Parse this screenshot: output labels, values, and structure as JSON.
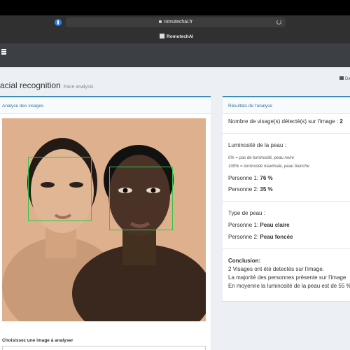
{
  "browser": {
    "url": "romutechai.fr",
    "tab_title": "RomutechAI"
  },
  "page": {
    "title": "acial recognition",
    "subtitle": "Face analysis",
    "breadcrumb": "Da"
  },
  "left_panel": {
    "header": "Analyse des visages",
    "choose_label": "Choisissez une image à analyser"
  },
  "right_panel": {
    "header": "Résultats de l'analyse",
    "faces_count_label": "Nombre de visage(s) détecté(s) sur l'image : ",
    "faces_count_value": "2",
    "luminosity_title": "Luminosité de la peau :",
    "luminosity_note_0": "0% = pas de luminosité, peau noire",
    "luminosity_note_100": "100% = luminosité maximale, peau blanche",
    "p1_lum_label": "Personne 1: ",
    "p1_lum_value": "76 %",
    "p2_lum_label": "Personne 2: ",
    "p2_lum_value": "35 %",
    "skin_type_title": "Type de peau :",
    "p1_skin_label": "Personne 1: ",
    "p1_skin_value": "Peau claire",
    "p2_skin_label": "Personne 2: ",
    "p2_skin_value": "Peau foncée",
    "conclusion_title": "Conclusion:",
    "conclusion_line1": "2 Visages ont été detectés sur l'image.",
    "conclusion_line2": "La majorité des personnes présente sur l'image",
    "conclusion_line3": "En moyenne la luminosité de la peau est de 55 %"
  },
  "colors": {
    "accent": "#3c8dbc",
    "detection_box": "#2fc64a",
    "navbar": "#3c4044"
  }
}
